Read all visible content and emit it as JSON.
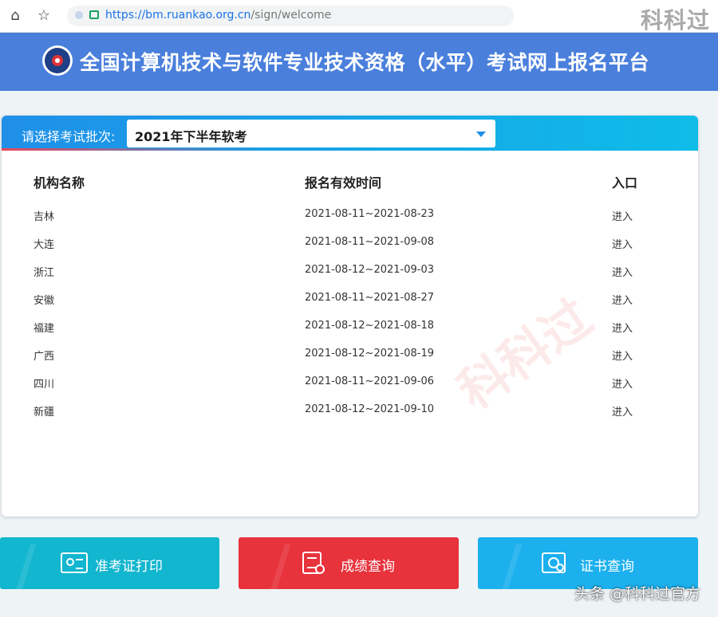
{
  "browser": {
    "url_host": "https://bm.ruankao.org.cn",
    "url_path": "/sign/welcome",
    "home_icon": "home-icon",
    "bookmark_icon": "star-icon"
  },
  "corner_watermark": "科科过",
  "header": {
    "title": "全国计算机技术与软件专业技术资格（水平）考试网上报名平台"
  },
  "batch_select": {
    "label": "请选择考试批次:",
    "value": "2021年下半年软考"
  },
  "table": {
    "columns": [
      "机构名称",
      "报名有效时间",
      "入口"
    ],
    "rows": [
      {
        "org": "吉林",
        "period": "2021-08-11~2021-08-23",
        "entry": "进入"
      },
      {
        "org": "大连",
        "period": "2021-08-11~2021-09-08",
        "entry": "进入"
      },
      {
        "org": "浙江",
        "period": "2021-08-12~2021-09-03",
        "entry": "进入"
      },
      {
        "org": "安徽",
        "period": "2021-08-11~2021-08-27",
        "entry": "进入"
      },
      {
        "org": "福建",
        "period": "2021-08-12~2021-08-18",
        "entry": "进入"
      },
      {
        "org": "广西",
        "period": "2021-08-12~2021-08-19",
        "entry": "进入"
      },
      {
        "org": "四川",
        "period": "2021-08-11~2021-09-06",
        "entry": "进入"
      },
      {
        "org": "新疆",
        "period": "2021-08-12~2021-09-10",
        "entry": "进入"
      }
    ]
  },
  "content_watermark": "科科过",
  "buttons": [
    {
      "label": "准考证打印",
      "icon": "id-card-icon",
      "color": "#12b6cf"
    },
    {
      "label": "成绩查询",
      "icon": "document-search-icon",
      "color": "#e8323c"
    },
    {
      "label": "证书查询",
      "icon": "certificate-search-icon",
      "color": "#1cb0ee"
    }
  ],
  "footer_credit": "头条 @科科过官方"
}
